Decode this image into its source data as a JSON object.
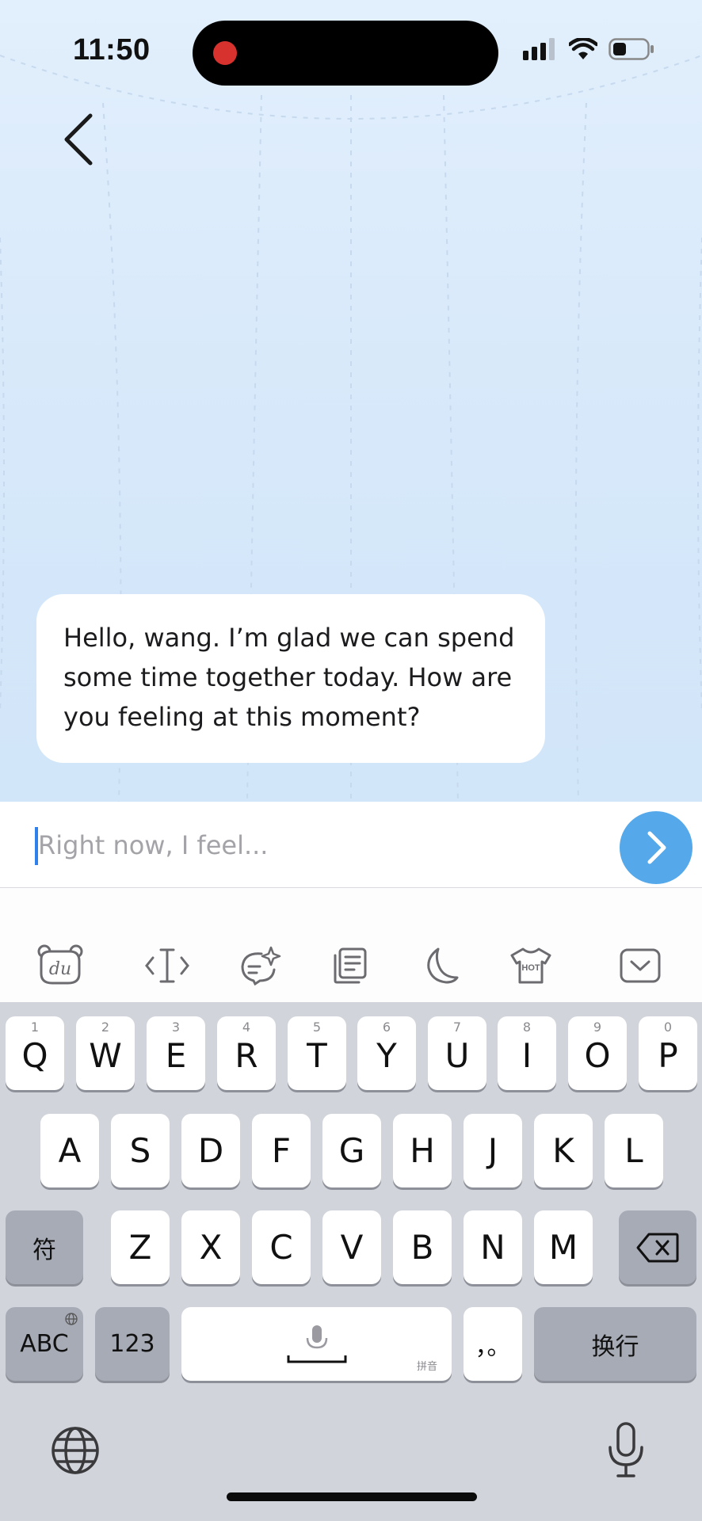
{
  "status_bar": {
    "time": "11:50"
  },
  "chat": {
    "message": "Hello, wang. I’m glad we can spend some time together today. How are you feeling at this moment?"
  },
  "input": {
    "placeholder": "Right now, I feel...",
    "value": ""
  },
  "keyboard": {
    "row1": [
      {
        "num": "1",
        "letter": "Q"
      },
      {
        "num": "2",
        "letter": "W"
      },
      {
        "num": "3",
        "letter": "E"
      },
      {
        "num": "4",
        "letter": "R"
      },
      {
        "num": "5",
        "letter": "T"
      },
      {
        "num": "6",
        "letter": "Y"
      },
      {
        "num": "7",
        "letter": "U"
      },
      {
        "num": "8",
        "letter": "I"
      },
      {
        "num": "9",
        "letter": "O"
      },
      {
        "num": "0",
        "letter": "P"
      }
    ],
    "row2": [
      "A",
      "S",
      "D",
      "F",
      "G",
      "H",
      "J",
      "K",
      "L"
    ],
    "row3": [
      "Z",
      "X",
      "C",
      "V",
      "B",
      "N",
      "M"
    ],
    "symbol_key": "符",
    "abc_key": "ABC",
    "num_key": "123",
    "space_hint": "拼音",
    "punct_key": "，。",
    "return_key": "换行"
  },
  "toolbar_icons": [
    "du-logo-icon",
    "text-cursor-icon",
    "ai-chat-icon",
    "clipboard-icon",
    "moon-icon",
    "hot-shirt-icon",
    "dismiss-keyboard-icon"
  ],
  "toolbar": {
    "hot_label": "HOT",
    "du_label": "du"
  }
}
